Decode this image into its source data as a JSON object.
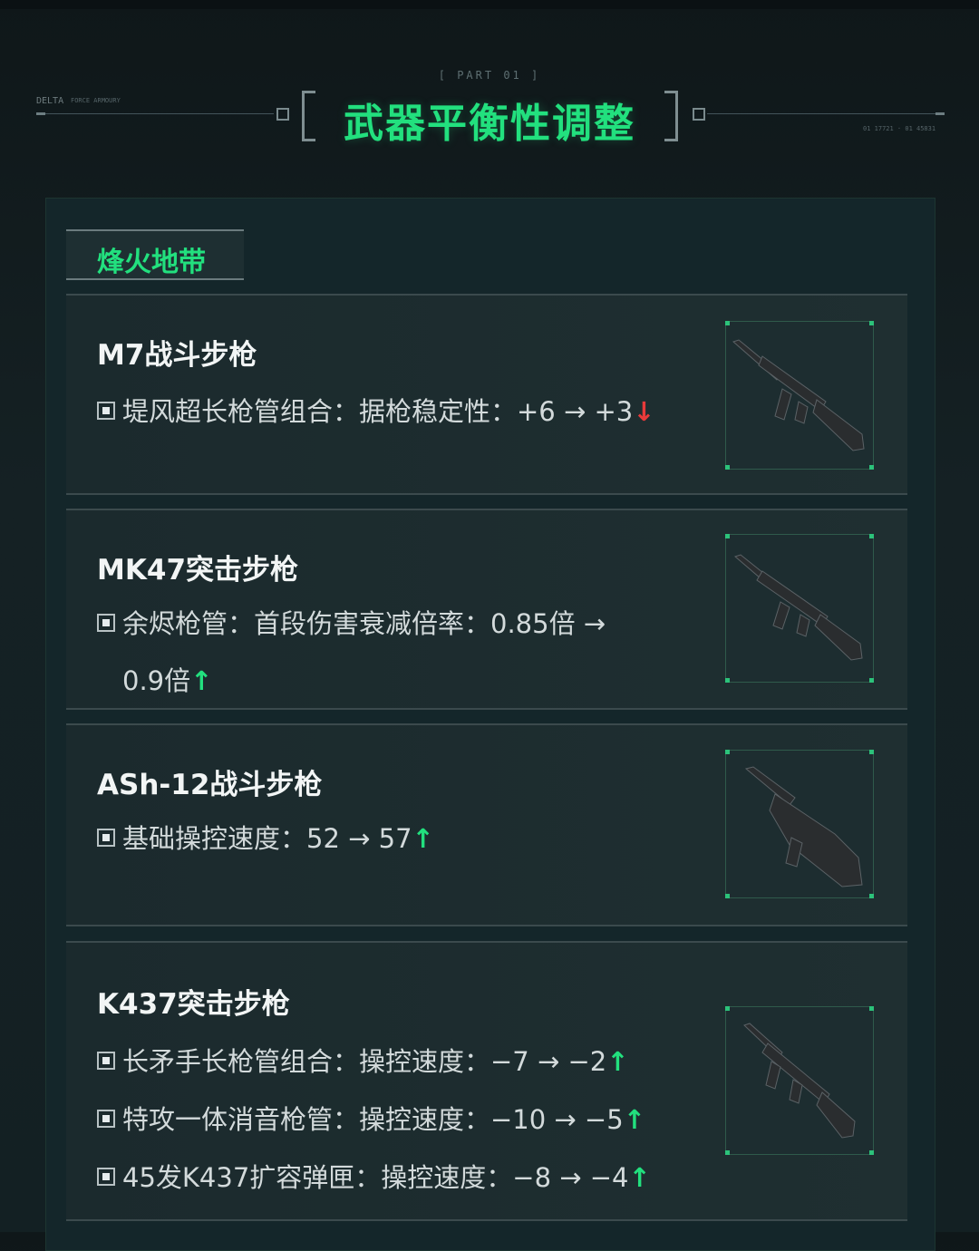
{
  "header": {
    "part_label": "[ PART 01 ]",
    "title": "武器平衡性调整",
    "left_tag": "DELTA",
    "left_tag_small": "FORCE ARMOURY",
    "right_tag_small": "01 17721 · 01 45831"
  },
  "section": {
    "tab_label": "烽火地带"
  },
  "weapons": [
    {
      "name": "M7战斗步枪",
      "changes": [
        {
          "text": "堤风超长枪管组合：据枪稳定性：+6 → +3",
          "arrow": "↓",
          "direction": "down"
        }
      ],
      "thumbnail_icon": "rifle-icon"
    },
    {
      "name": "MK47突击步枪",
      "changes": [
        {
          "text": "余烬枪管：首段伤害衰减倍率：0.85倍 →",
          "continuation": "0.9倍",
          "arrow": "↑",
          "direction": "up"
        }
      ],
      "thumbnail_icon": "rifle-icon"
    },
    {
      "name": "ASh-12战斗步枪",
      "changes": [
        {
          "text": "基础操控速度：52 → 57",
          "arrow": "↑",
          "direction": "up"
        }
      ],
      "thumbnail_icon": "bullpup-rifle-icon"
    },
    {
      "name": "K437突击步枪",
      "changes": [
        {
          "text": "长矛手长枪管组合：操控速度：−7 → −2",
          "arrow": "↑",
          "direction": "up"
        },
        {
          "text": "特攻一体消音枪管：操控速度：−10 → −5",
          "arrow": "↑",
          "direction": "up"
        },
        {
          "text": "45发K437扩容弹匣：操控速度：−8 → −4",
          "arrow": "↑",
          "direction": "up"
        }
      ],
      "thumbnail_icon": "rifle-icon"
    }
  ],
  "colors": {
    "accent_green": "#22e07e",
    "nerf_red": "#e83a3a",
    "background": "#14262a"
  }
}
